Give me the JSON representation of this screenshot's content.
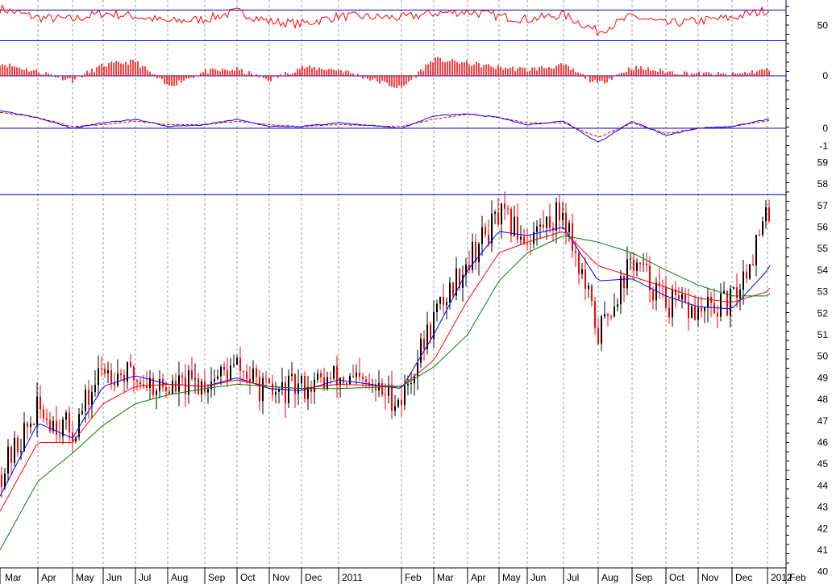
{
  "colors": {
    "background": "#ffffff",
    "grid": "#9a9a9a",
    "reference_line": "#0000cc",
    "up_candle": "#000000",
    "down_candle": "#ff0000",
    "ma_fast": "#0000ff",
    "ma_mid": "#ff0000",
    "ma_slow": "#008000",
    "oscillator": "#ff0000",
    "histogram": "#ff0000",
    "macd_line": "#0000ff",
    "signal_line": "#ff0000"
  },
  "chart_data": [
    {
      "type": "line",
      "panel": "oscillator",
      "y_tick_labels": [
        "50"
      ],
      "reference_levels": [
        70,
        30
      ],
      "ylim": [
        20,
        80
      ],
      "series": [
        {
          "values_by_month": [
            "Mar",
            "Apr",
            "May",
            "Jun",
            "Jul",
            "Aug",
            "Sep",
            "Oct",
            "Nov",
            "Dec",
            "2011",
            "Feb",
            "Mar",
            "Apr",
            "May",
            "Jun",
            "Jul",
            "Aug",
            "Sep",
            "Oct",
            "Nov",
            "Dec",
            "2012",
            "Feb"
          ],
          "values": [
            72,
            60,
            58,
            66,
            62,
            55,
            58,
            68,
            55,
            52,
            62,
            60,
            66,
            68,
            62,
            58,
            64,
            42,
            62,
            52,
            56,
            60,
            70,
            62
          ]
        }
      ]
    },
    {
      "type": "bar",
      "panel": "histogram",
      "y_tick_labels": [
        "0"
      ],
      "ylim": [
        -1,
        1
      ],
      "categories": [
        "Mar",
        "Apr",
        "May",
        "Jun",
        "Jul",
        "Aug",
        "Sep",
        "Oct",
        "Nov",
        "Dec",
        "2011",
        "Feb",
        "Mar",
        "Apr",
        "May",
        "Jun",
        "Jul",
        "Aug",
        "Sep",
        "Oct",
        "Nov",
        "Dec",
        "2012",
        "Feb"
      ],
      "values": [
        0.6,
        0.2,
        -0.2,
        0.5,
        0.7,
        -0.5,
        0.2,
        0.3,
        -0.2,
        0.4,
        0.3,
        -0.6,
        0.8,
        0.6,
        0.4,
        0.3,
        0.5,
        -0.4,
        0.4,
        0.2,
        0.1,
        0.05,
        0.3,
        0.2
      ]
    },
    {
      "type": "line",
      "panel": "macd",
      "y_tick_labels": [
        "0",
        "-1"
      ],
      "ylim": [
        -1.4,
        1.4
      ],
      "x": [
        "Mar",
        "Apr",
        "May",
        "Jun",
        "Jul",
        "Aug",
        "Sep",
        "Oct",
        "Nov",
        "Dec",
        "2011",
        "Feb",
        "Mar",
        "Apr",
        "May",
        "Jun",
        "Jul",
        "Aug",
        "Sep",
        "Oct",
        "Nov",
        "Dec",
        "2012",
        "Feb"
      ],
      "series": [
        {
          "values": [
            1.0,
            0.6,
            0.0,
            0.3,
            0.5,
            0.1,
            0.2,
            0.5,
            0.1,
            0.1,
            0.3,
            0.0,
            0.7,
            0.8,
            0.6,
            0.2,
            0.4,
            -0.8,
            0.4,
            -0.4,
            0.0,
            0.1,
            0.5,
            0.9
          ]
        },
        {
          "values": [
            0.9,
            0.6,
            0.1,
            0.2,
            0.4,
            0.2,
            0.2,
            0.4,
            0.2,
            0.1,
            0.2,
            0.1,
            0.5,
            0.8,
            0.6,
            0.3,
            0.3,
            -0.5,
            0.3,
            -0.3,
            0.0,
            0.1,
            0.4,
            0.8
          ]
        }
      ]
    },
    {
      "type": "line",
      "panel": "price",
      "ylim": [
        40,
        59
      ],
      "y_tick_labels": [
        "59",
        "58",
        "57",
        "56",
        "55",
        "54",
        "53",
        "52",
        "51",
        "50",
        "49",
        "48",
        "47",
        "46",
        "45",
        "44",
        "43",
        "42",
        "41",
        "40"
      ],
      "x_tick_labels": [
        "Mar",
        "Apr",
        "May",
        "Jun",
        "Jul",
        "Aug",
        "Sep",
        "Oct",
        "Nov",
        "Dec",
        "2011",
        "Feb",
        "Mar",
        "Apr",
        "May",
        "Jun",
        "Jul",
        "Aug",
        "Sep",
        "Oct",
        "Nov",
        "Dec",
        "2012",
        "Feb"
      ],
      "reference_levels": [
        57.5
      ],
      "series": [
        {
          "style": "candlestick",
          "values": [
            44.5,
            47.5,
            46.5,
            49.5,
            49.0,
            48.5,
            48.8,
            49.5,
            48.2,
            48.6,
            49.0,
            48.0,
            51.8,
            54.5,
            56.5,
            55.5,
            56.8,
            51.0,
            54.5,
            52.5,
            52.0,
            52.5,
            56.5,
            57.0
          ]
        },
        {
          "values": [
            43.5,
            46.9,
            46.2,
            48.6,
            49.1,
            48.7,
            48.6,
            49.0,
            48.5,
            48.4,
            48.9,
            48.5,
            51.0,
            54.0,
            55.8,
            55.6,
            56.0,
            53.5,
            53.6,
            52.8,
            52.3,
            52.2,
            54.0,
            55.6
          ]
        },
        {
          "values": [
            42.8,
            46.0,
            46.0,
            47.8,
            48.6,
            48.7,
            48.6,
            48.9,
            48.6,
            48.5,
            48.7,
            48.6,
            49.8,
            52.6,
            54.8,
            55.3,
            55.8,
            54.2,
            53.7,
            53.2,
            52.7,
            52.5,
            53.0,
            54.3
          ]
        },
        {
          "values": [
            41.0,
            44.2,
            45.5,
            46.8,
            47.8,
            48.2,
            48.5,
            48.7,
            48.6,
            48.5,
            48.5,
            48.6,
            49.5,
            51.0,
            53.5,
            54.8,
            55.6,
            55.3,
            54.8,
            54.0,
            53.3,
            52.8,
            52.8,
            53.6
          ]
        }
      ]
    }
  ]
}
